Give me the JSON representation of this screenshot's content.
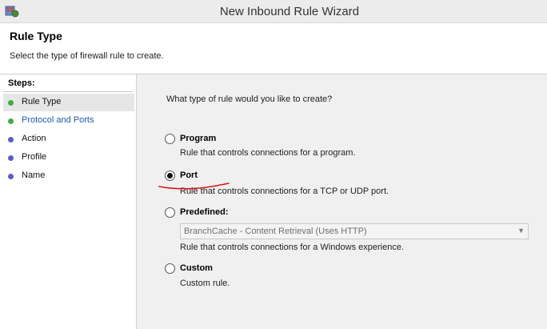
{
  "window": {
    "title": "New Inbound Rule Wizard",
    "icon": "firewall-icon"
  },
  "header": {
    "title": "Rule Type",
    "description": "Select the type of firewall rule to create."
  },
  "steps": {
    "label": "Steps:",
    "items": [
      {
        "label": "Rule Type",
        "dot_color": "#3fae3f",
        "active": true
      },
      {
        "label": "Protocol and Ports",
        "dot_color": "#3fae3f",
        "link": true
      },
      {
        "label": "Action",
        "dot_color": "#5b5bc8"
      },
      {
        "label": "Profile",
        "dot_color": "#5b5bc8"
      },
      {
        "label": "Name",
        "dot_color": "#5b5bc8"
      }
    ]
  },
  "main": {
    "question": "What type of rule would you like to create?",
    "options": [
      {
        "label": "Program",
        "description": "Rule that controls connections for a program.",
        "selected": false
      },
      {
        "label": "Port",
        "description": "Rule that controls connections for a TCP or UDP port.",
        "selected": true
      },
      {
        "label": "Predefined:",
        "description": "Rule that controls connections for a Windows experience.",
        "selected": false,
        "select_value": "BranchCache - Content Retrieval (Uses HTTP)"
      },
      {
        "label": "Custom",
        "description": "Custom rule.",
        "selected": false
      }
    ]
  },
  "annotation_color": "#d8141c"
}
